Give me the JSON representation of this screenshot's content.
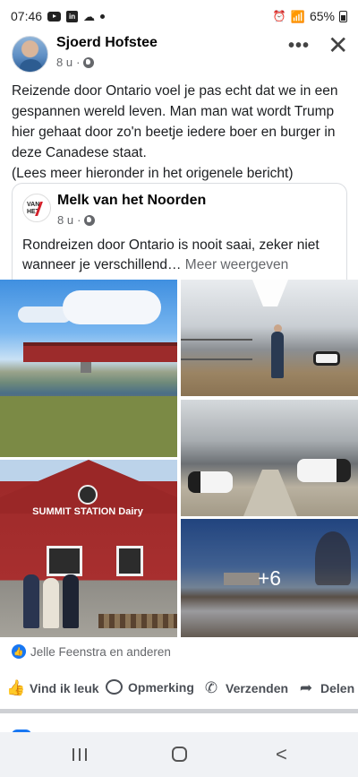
{
  "status_bar": {
    "time": "07:46",
    "battery": "65%"
  },
  "post": {
    "author": "Sjoerd Hofstee",
    "time": "8 u",
    "more_label": "•••",
    "close_label": "✕",
    "text": "Reizende door Ontario voel je pas echt dat we in een gespannen wereld leven. Man man wat wordt Trump hier gehaat door zo'n beetje iedere boer en burger in deze Canadese staat.\n(Lees meer hieronder in het origenele bericht)"
  },
  "shared": {
    "logo_text": "VAN HET",
    "page_name": "Melk van het Noorden",
    "time": "8 u",
    "text": "Rondreizen door Ontario is nooit saai, zeker niet wanneer je verschillend…",
    "see_more": "Meer weergeven"
  },
  "photos": {
    "sign_text": "SUMMIT STATION Dairy",
    "more_count": "+6"
  },
  "reactions": {
    "text": "Jelle Feenstra en anderen"
  },
  "actions": {
    "like": "Vind ik leuk",
    "comment": "Opmerking",
    "send": "Verzenden",
    "share": "Delen"
  },
  "colors": {
    "accent": "#1877f2",
    "text": "#1c1e21",
    "muted": "#65676b"
  }
}
